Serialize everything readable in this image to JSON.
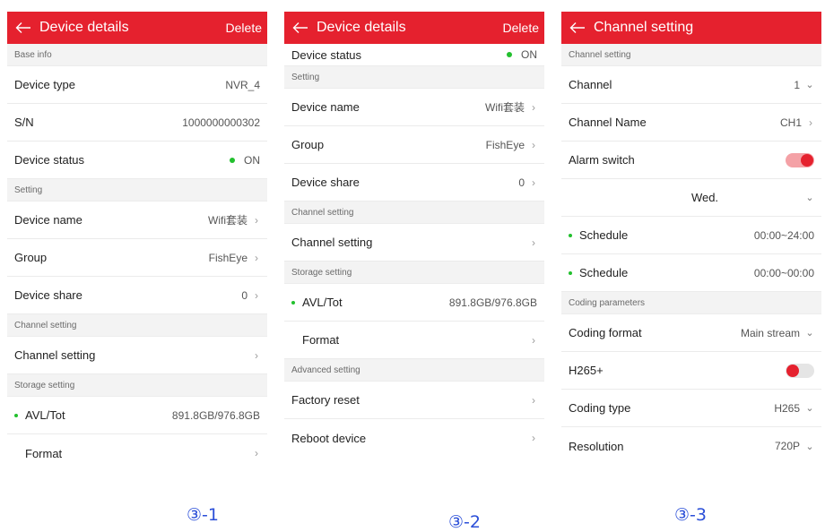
{
  "screen1": {
    "title": "Device details",
    "action": "Delete",
    "base_info": "Base info",
    "device_type_label": "Device type",
    "device_type_value": "NVR_4",
    "sn_label": "S/N",
    "sn_value": "1000000000302",
    "device_status_label": "Device status",
    "device_status_value": "ON",
    "setting_header": "Setting",
    "device_name_label": "Device name",
    "device_name_value": "Wifi套装",
    "group_label": "Group",
    "group_value": "FishEye",
    "device_share_label": "Device share",
    "device_share_value": "0",
    "channel_setting_header": "Channel setting",
    "channel_setting_label": "Channel setting",
    "storage_header": "Storage setting",
    "avl_label": "AVL/Tot",
    "avl_value": "891.8GB/976.8GB",
    "format_label": "Format",
    "caption": "③-1"
  },
  "screen2": {
    "title": "Device details",
    "action": "Delete",
    "device_status_label": "Device status",
    "device_status_value": "ON",
    "setting_header": "Setting",
    "device_name_label": "Device name",
    "device_name_value": "Wifi套装",
    "group_label": "Group",
    "group_value": "FishEye",
    "device_share_label": "Device share",
    "device_share_value": "0",
    "channel_setting_header": "Channel setting",
    "channel_setting_label": "Channel setting",
    "storage_header": "Storage setting",
    "avl_label": "AVL/Tot",
    "avl_value": "891.8GB/976.8GB",
    "format_label": "Format",
    "advanced_header": "Advanced setting",
    "factory_reset_label": "Factory reset",
    "reboot_label": "Reboot device",
    "caption": "③-2"
  },
  "screen3": {
    "title": "Channel setting",
    "channel_setting_header": "Channel setting",
    "channel_label": "Channel",
    "channel_value": "1",
    "channel_name_label": "Channel Name",
    "channel_name_value": "CH1",
    "alarm_switch_label": "Alarm switch",
    "alarm_switch_on": true,
    "day_value": "Wed.",
    "schedule1_label": "Schedule",
    "schedule1_value": "00:00~24:00",
    "schedule2_label": "Schedule",
    "schedule2_value": "00:00~00:00",
    "coding_header": "Coding parameters",
    "coding_format_label": "Coding format",
    "coding_format_value": "Main stream",
    "h265plus_label": "H265+",
    "h265plus_on": false,
    "coding_type_label": "Coding type",
    "coding_type_value": "H265",
    "resolution_label": "Resolution",
    "resolution_value": "720P",
    "caption": "③-3"
  },
  "colors": {
    "accent": "#e5212e",
    "status_green": "#22c02e",
    "caption_blue": "#2b4fd8"
  },
  "icons": {
    "back": "arrow-left-icon",
    "chevron_right": "chevron-right-icon",
    "chevron_down": "chevron-down-icon",
    "status_dot": "status-dot-icon"
  }
}
